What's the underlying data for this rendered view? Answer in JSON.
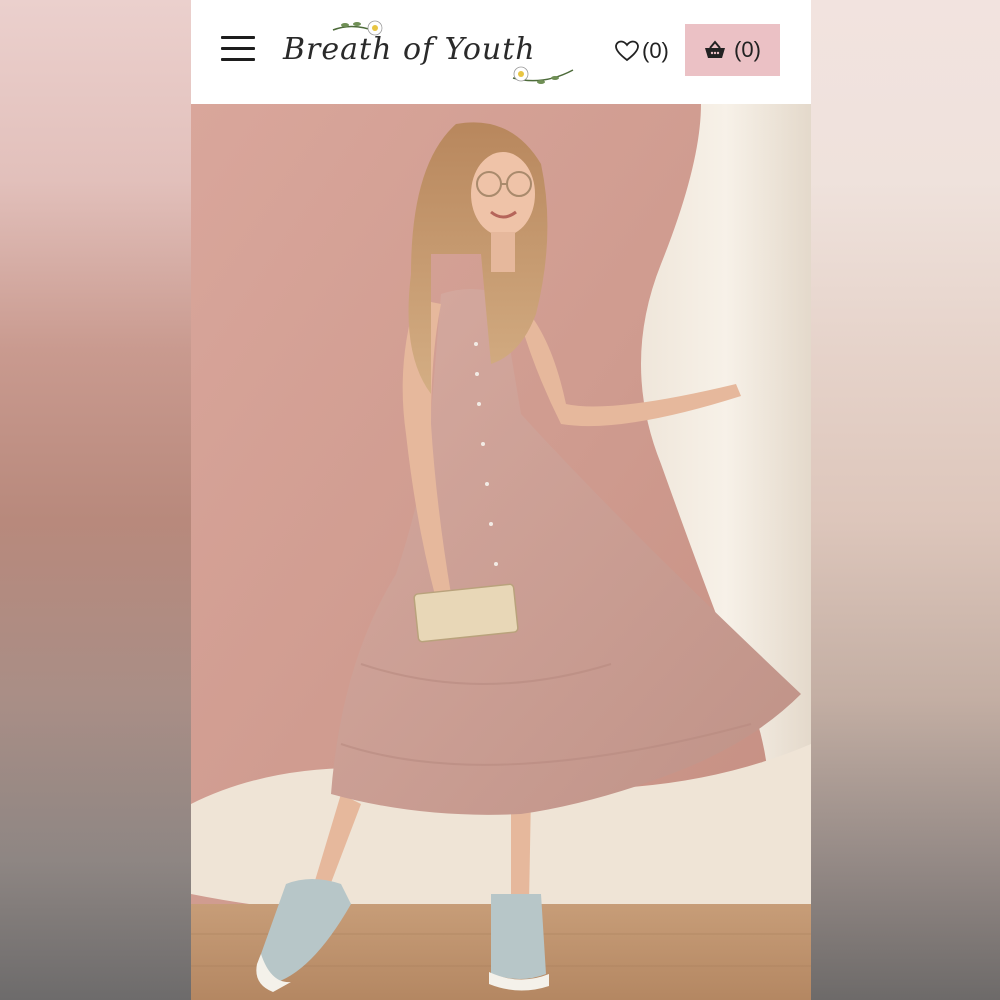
{
  "header": {
    "logo_text": "Breath of Youth",
    "wishlist_count": "(0)",
    "cart_count": "(0)",
    "menu_icon": "hamburger-icon",
    "wishlist_icon": "heart-icon",
    "cart_icon": "basket-icon"
  },
  "colors": {
    "cart_bg": "#ebc1c5",
    "header_bg": "#ffffff"
  },
  "photo": {
    "alt": "Model in pink floral tiered midi dress"
  }
}
